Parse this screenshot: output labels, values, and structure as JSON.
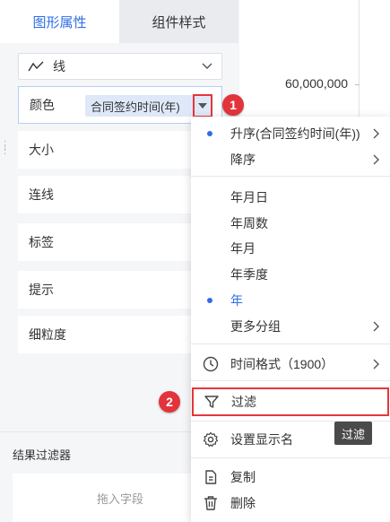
{
  "tabs": {
    "graph_props": "图形属性",
    "component_style": "组件样式"
  },
  "chart_type": {
    "label": "线",
    "icon": "line-chart-icon"
  },
  "properties": {
    "color_label": "颜色",
    "color_field": "合同签约时间(年)",
    "size_label": "大小",
    "line_label": "连线",
    "tag_label": "标签",
    "tip_label": "提示",
    "granularity_label": "细粒度"
  },
  "badges": {
    "first": "1",
    "second": "2"
  },
  "chart_axis": {
    "tick_label": "60,000,000"
  },
  "result_filter": {
    "title": "结果过滤器",
    "drop_hint": "拖入字段"
  },
  "menu": {
    "sort_asc": "升序(合同签约时间(年))",
    "sort_desc": "降序",
    "ymd": "年月日",
    "year_week": "年周数",
    "year_month": "年月",
    "year_quarter": "年季度",
    "year": "年",
    "more_group": "更多分组",
    "time_format": "时间格式（1900）",
    "filter": "过滤",
    "set_display_name": "设置显示名",
    "copy": "复制",
    "delete": "删除"
  },
  "tooltip": {
    "text": "过滤"
  },
  "colors": {
    "accent": "#2e6ee6",
    "highlight_red": "#e5373c",
    "pill_bg": "#dfe8f8"
  }
}
